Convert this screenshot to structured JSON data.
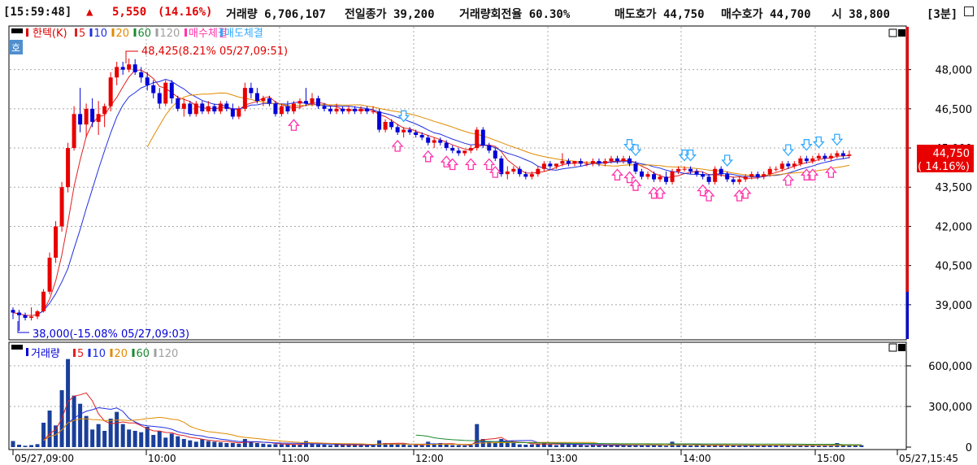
{
  "header": {
    "time": "[15:59:48]",
    "up_icon": "▲",
    "change": "5,550",
    "change_pct": "(14.16%)",
    "volume": "거래량 6,706,107",
    "prev_close": "전일종가 39,200",
    "turnover": "거래량회전율 60.30%",
    "ask": "매도호가 44,750",
    "bid": "매수호가 44,700",
    "open": "시 38,800",
    "interval": "[3분]"
  },
  "colors": {
    "up": "#e80000",
    "down": "#0000d8",
    "ma5": "#e02020",
    "ma10": "#2030e0",
    "ma20": "#e08a00",
    "ma60": "#1a8a30",
    "ma120": "#a0a0a0",
    "buy_arrow": "#ff33aa",
    "sell_arrow": "#33aaff",
    "grid": "#a8a8a8"
  },
  "icons": {
    "window_buttons": "minimize-close-icon",
    "buy_marker": "hollow-up-arrow-icon",
    "sell_marker": "hollow-down-arrow-icon"
  },
  "chart_data": [
    {
      "type": "candlestick",
      "title": "한텍(K)",
      "legend": [
        {
          "name": "5",
          "color": "#e02020"
        },
        {
          "name": "10",
          "color": "#2030e0"
        },
        {
          "name": "20",
          "color": "#e08a00"
        },
        {
          "name": "60",
          "color": "#1a8a30"
        },
        {
          "name": "120",
          "color": "#a0a0a0"
        },
        {
          "name": "매수체결",
          "color": "#ff33aa"
        },
        {
          "name": "매도체결",
          "color": "#33aaff"
        }
      ],
      "badge": "호",
      "y_ticks": [
        "48,000",
        "46,500",
        "45,000",
        "43,500",
        "42,000",
        "40,500",
        "39,000"
      ],
      "y_tick_values": [
        48000,
        46500,
        45000,
        43500,
        42000,
        40500,
        39000
      ],
      "ylim": [
        37720,
        49420
      ],
      "x_ticks": [
        "05/27,09:00",
        "10:00",
        "11:00",
        "12:00",
        "13:00",
        "14:00",
        "15:00",
        "05/27,15:45"
      ],
      "high_annotation": "48,425(8.21% 05/27,09:51)",
      "low_annotation": "38,000(-15.08% 05/27,09:03)",
      "current_price": "44,750",
      "current_pct": "( 14.16%)",
      "candles": [
        [
          38800,
          38900,
          38450,
          38700
        ],
        [
          38700,
          38800,
          38000,
          38600
        ],
        [
          38600,
          38700,
          38400,
          38500
        ],
        [
          38500,
          38900,
          38400,
          38550
        ],
        [
          38550,
          38800,
          38450,
          38750
        ],
        [
          38750,
          39600,
          38700,
          39500
        ],
        [
          39500,
          41000,
          39400,
          40800
        ],
        [
          40800,
          42200,
          40600,
          42000
        ],
        [
          42000,
          43700,
          41800,
          43500
        ],
        [
          43500,
          45200,
          43300,
          45000
        ],
        [
          45000,
          46600,
          44900,
          46300
        ],
        [
          46300,
          47300,
          45600,
          45900
        ],
        [
          45900,
          46700,
          45400,
          46500
        ],
        [
          46500,
          46900,
          45800,
          46000
        ],
        [
          46000,
          46800,
          45500,
          46300
        ],
        [
          46300,
          46700,
          45800,
          46600
        ],
        [
          46600,
          47900,
          46400,
          47700
        ],
        [
          47700,
          48300,
          47400,
          48100
        ],
        [
          48100,
          48300,
          47800,
          48000
        ],
        [
          48000,
          48425,
          47900,
          48200
        ],
        [
          48200,
          48400,
          47800,
          47900
        ],
        [
          47900,
          48100,
          47500,
          47700
        ],
        [
          47700,
          47900,
          47200,
          47400
        ],
        [
          47400,
          47600,
          46900,
          47100
        ],
        [
          47100,
          47300,
          46500,
          46700
        ],
        [
          46700,
          47600,
          46600,
          47500
        ],
        [
          47500,
          47600,
          46700,
          46900
        ],
        [
          46900,
          47000,
          46400,
          46500
        ],
        [
          46500,
          46900,
          46200,
          46700
        ],
        [
          46700,
          46800,
          46200,
          46300
        ],
        [
          46300,
          46800,
          46200,
          46700
        ],
        [
          46700,
          46800,
          46300,
          46400
        ],
        [
          46400,
          46800,
          46300,
          46600
        ],
        [
          46600,
          46700,
          46300,
          46400
        ],
        [
          46400,
          46800,
          46300,
          46700
        ],
        [
          46700,
          46800,
          46400,
          46500
        ],
        [
          46500,
          46700,
          46100,
          46200
        ],
        [
          46200,
          46600,
          46100,
          46500
        ],
        [
          46500,
          47500,
          46400,
          47300
        ],
        [
          47300,
          47500,
          46900,
          47100
        ],
        [
          47100,
          47300,
          46700,
          46800
        ],
        [
          46800,
          47000,
          46600,
          46900
        ],
        [
          46900,
          47000,
          46600,
          46700
        ],
        [
          46700,
          46800,
          46200,
          46300
        ],
        [
          46300,
          46700,
          46200,
          46600
        ],
        [
          46600,
          46800,
          46300,
          46400
        ],
        [
          46400,
          46800,
          46300,
          46700
        ],
        [
          46700,
          46900,
          46500,
          46800
        ],
        [
          46800,
          47300,
          46600,
          46700
        ],
        [
          46700,
          47100,
          46600,
          46900
        ],
        [
          46900,
          47000,
          46500,
          46600
        ],
        [
          46600,
          46700,
          46400,
          46500
        ],
        [
          46500,
          46600,
          46300,
          46400
        ],
        [
          46400,
          46700,
          46300,
          46500
        ],
        [
          46500,
          46600,
          46300,
          46400
        ],
        [
          46400,
          46600,
          46300,
          46500
        ],
        [
          46500,
          46600,
          46300,
          46400
        ],
        [
          46400,
          46600,
          46300,
          46500
        ],
        [
          46500,
          46600,
          46300,
          46400
        ],
        [
          46400,
          46600,
          46300,
          46400
        ],
        [
          46400,
          46500,
          45600,
          45700
        ],
        [
          45700,
          46100,
          45600,
          46000
        ],
        [
          46000,
          46100,
          45700,
          45800
        ],
        [
          45800,
          45900,
          45500,
          45600
        ],
        [
          45600,
          45800,
          45400,
          45700
        ],
        [
          45700,
          45800,
          45500,
          45600
        ],
        [
          45600,
          45700,
          45400,
          45500
        ],
        [
          45500,
          45600,
          45300,
          45400
        ],
        [
          45400,
          45500,
          45100,
          45200
        ],
        [
          45200,
          45400,
          45000,
          45300
        ],
        [
          45300,
          45400,
          45100,
          45200
        ],
        [
          45200,
          45300,
          44900,
          45000
        ],
        [
          45000,
          45100,
          44800,
          44900
        ],
        [
          44900,
          45000,
          44700,
          44800
        ],
        [
          44800,
          44900,
          44700,
          44900
        ],
        [
          44900,
          45100,
          44800,
          45000
        ],
        [
          45000,
          45800,
          44900,
          45700
        ],
        [
          45700,
          45800,
          45000,
          45100
        ],
        [
          45100,
          45200,
          44800,
          44900
        ],
        [
          44900,
          45000,
          44500,
          44600
        ],
        [
          44600,
          44700,
          43900,
          44000
        ],
        [
          44000,
          44300,
          43800,
          44100
        ],
        [
          44100,
          44300,
          44000,
          44200
        ],
        [
          44200,
          44300,
          43900,
          44000
        ],
        [
          44000,
          44100,
          43800,
          43900
        ],
        [
          43900,
          44100,
          43800,
          44000
        ],
        [
          44000,
          44300,
          43900,
          44200
        ],
        [
          44200,
          44500,
          44100,
          44400
        ],
        [
          44400,
          44500,
          44200,
          44300
        ],
        [
          44300,
          44400,
          44200,
          44400
        ],
        [
          44400,
          44800,
          44300,
          44500
        ],
        [
          44500,
          44600,
          44300,
          44400
        ],
        [
          44400,
          44500,
          44300,
          44500
        ],
        [
          44500,
          44600,
          44300,
          44400
        ],
        [
          44400,
          44500,
          44300,
          44400
        ],
        [
          44400,
          44600,
          44300,
          44500
        ],
        [
          44500,
          44600,
          44300,
          44400
        ],
        [
          44400,
          44600,
          44300,
          44500
        ],
        [
          44500,
          44700,
          44400,
          44600
        ],
        [
          44600,
          44700,
          44400,
          44500
        ],
        [
          44500,
          44700,
          44400,
          44600
        ],
        [
          44600,
          44700,
          44300,
          44400
        ],
        [
          44400,
          44500,
          44000,
          44100
        ],
        [
          44100,
          44200,
          43800,
          43900
        ],
        [
          43900,
          44100,
          43800,
          44000
        ],
        [
          44000,
          44100,
          43700,
          43800
        ],
        [
          43800,
          44000,
          43700,
          43900
        ],
        [
          43900,
          44100,
          43600,
          43700
        ],
        [
          43700,
          44200,
          43600,
          44100
        ],
        [
          44100,
          44300,
          44000,
          44200
        ],
        [
          44200,
          44300,
          44100,
          44200
        ],
        [
          44200,
          44300,
          44000,
          44100
        ],
        [
          44100,
          44200,
          43900,
          44000
        ],
        [
          44000,
          44100,
          43800,
          43900
        ],
        [
          43900,
          44000,
          43600,
          43700
        ],
        [
          43700,
          44300,
          43600,
          44200
        ],
        [
          44200,
          44300,
          43900,
          44000
        ],
        [
          44000,
          44100,
          43700,
          43800
        ],
        [
          43800,
          43900,
          43600,
          43700
        ],
        [
          43700,
          43900,
          43600,
          43800
        ],
        [
          43800,
          44000,
          43700,
          43900
        ],
        [
          43900,
          44100,
          43800,
          44000
        ],
        [
          44000,
          44100,
          43800,
          43900
        ],
        [
          43900,
          44100,
          43800,
          44000
        ],
        [
          44000,
          44300,
          43900,
          44200
        ],
        [
          44200,
          44300,
          44100,
          44200
        ],
        [
          44200,
          44500,
          44100,
          44400
        ],
        [
          44400,
          44500,
          44200,
          44300
        ],
        [
          44300,
          44500,
          44200,
          44400
        ],
        [
          44400,
          44700,
          44300,
          44600
        ],
        [
          44600,
          44700,
          44400,
          44500
        ],
        [
          44500,
          44700,
          44400,
          44600
        ],
        [
          44600,
          44800,
          44500,
          44700
        ],
        [
          44700,
          44800,
          44500,
          44600
        ],
        [
          44600,
          44800,
          44500,
          44700
        ],
        [
          44700,
          44900,
          44600,
          44800
        ],
        [
          44800,
          44900,
          44600,
          44700
        ],
        [
          44700,
          44900,
          44600,
          44750
        ]
      ],
      "buy_marks": [
        46,
        63,
        68,
        71,
        72,
        75,
        78,
        79,
        99,
        101,
        102,
        105,
        106,
        113,
        114,
        119,
        120,
        127,
        130,
        131,
        134
      ],
      "sell_marks": [
        64,
        101,
        102,
        110,
        111,
        117,
        127,
        130,
        132,
        135
      ]
    },
    {
      "type": "bar",
      "title": "거래량",
      "legend": [
        {
          "name": "5",
          "color": "#e02020"
        },
        {
          "name": "10",
          "color": "#2030e0"
        },
        {
          "name": "20",
          "color": "#e08a00"
        },
        {
          "name": "60",
          "color": "#1a8a30"
        },
        {
          "name": "120",
          "color": "#a0a0a0"
        }
      ],
      "y_ticks": [
        "600,000",
        "300,000",
        "0"
      ],
      "y_tick_values": [
        600000,
        300000,
        0
      ],
      "ylim": [
        0,
        720000
      ],
      "values": [
        45000,
        18000,
        10000,
        15000,
        22000,
        180000,
        270000,
        160000,
        420000,
        650000,
        380000,
        320000,
        230000,
        130000,
        170000,
        120000,
        210000,
        260000,
        170000,
        130000,
        120000,
        110000,
        150000,
        90000,
        120000,
        70000,
        100000,
        80000,
        60000,
        50000,
        40000,
        60000,
        45000,
        40000,
        35000,
        30000,
        30000,
        25000,
        60000,
        40000,
        30000,
        25000,
        20000,
        22000,
        20000,
        20000,
        18000,
        20000,
        45000,
        25000,
        20000,
        18000,
        15000,
        20000,
        15000,
        18000,
        15000,
        16000,
        14000,
        15000,
        50000,
        30000,
        25000,
        20000,
        18000,
        15000,
        15000,
        14000,
        40000,
        20000,
        30000,
        20000,
        15000,
        14000,
        12000,
        15000,
        170000,
        60000,
        40000,
        30000,
        60000,
        40000,
        30000,
        20000,
        18000,
        20000,
        25000,
        30000,
        20000,
        15000,
        25000,
        20000,
        18000,
        15000,
        12000,
        15000,
        14000,
        12000,
        15000,
        14000,
        14000,
        12000,
        20000,
        15000,
        20000,
        12000,
        15000,
        10000,
        40000,
        20000,
        15000,
        12000,
        15000,
        14000,
        12000,
        15000,
        14000,
        12000,
        12000,
        10000,
        12000,
        15000,
        14000,
        12000,
        15000,
        14000,
        12000,
        10000,
        12000,
        15000,
        14000,
        12000,
        10000,
        12000,
        15000,
        30000,
        12000,
        15000,
        12000,
        14000
      ]
    }
  ]
}
